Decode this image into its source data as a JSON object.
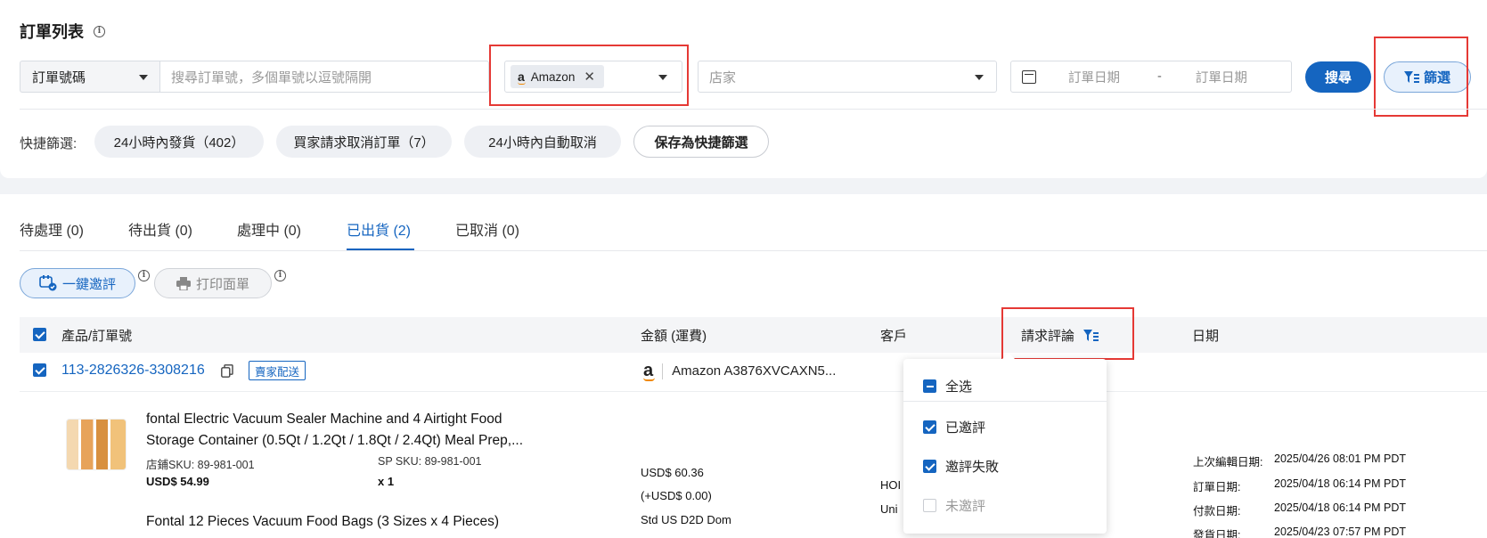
{
  "header": {
    "title": "訂單列表",
    "info_icon": "info-icon"
  },
  "search": {
    "type_selected": "訂單號碼",
    "placeholder": "搜尋訂單號，多個單號以逗號隔開",
    "platform_chip": "Amazon",
    "shop_placeholder": "店家",
    "date_start_placeholder": "訂單日期",
    "date_separator": "-",
    "date_end_placeholder": "訂單日期",
    "search_button": "搜尋",
    "filter_button": "篩選"
  },
  "quick_filters": {
    "label": "快捷篩選:",
    "items": [
      "24小時內發貨（402）",
      "買家請求取消訂單（7）",
      "24小時內自動取消"
    ],
    "save_button": "保存為快捷篩選"
  },
  "tabs": [
    {
      "label": "待處理 (0)",
      "active": false
    },
    {
      "label": "待出貨 (0)",
      "active": false
    },
    {
      "label": "處理中 (0)",
      "active": false
    },
    {
      "label": "已出貨 (2)",
      "active": true
    },
    {
      "label": "已取消 (0)",
      "active": false
    }
  ],
  "actions": {
    "review_button": "一鍵邀評",
    "print_button": "打印面單"
  },
  "table": {
    "headers": {
      "product": "產品/訂單號",
      "amount": "金額 (運費)",
      "customer": "客戶",
      "review": "請求評論",
      "date": "日期"
    },
    "order": {
      "order_no": "113-2826326-3308216",
      "tag": "賣家配送",
      "shop": "Amazon A3876XVCAXN5..."
    },
    "items": [
      {
        "name_line1": "fontal Electric Vacuum Sealer Machine and 4 Airtight Food",
        "name_line2": "Storage Container (0.5Qt / 1.2Qt / 1.8Qt / 2.4Qt) Meal Prep,...",
        "shop_sku": "店鋪SKU: 89-981-001",
        "sp_sku": "SP SKU: 89-981-001",
        "price": "USD$ 54.99",
        "qty": "x 1"
      },
      {
        "name_line1": "Fontal 12 Pieces Vacuum Food Bags (3 Sizes x 4 Pieces)"
      }
    ],
    "amount": {
      "total": "USD$ 60.36",
      "shipping": "(+USD$ 0.00)",
      "method": "Std US D2D Dom"
    },
    "customer_partial": [
      "HOI",
      "Uni"
    ],
    "dates": [
      {
        "label": "上次編輯日期:",
        "value": "2025/04/26 08:01 PM PDT"
      },
      {
        "label": "訂單日期:",
        "value": "2025/04/18 06:14 PM PDT"
      },
      {
        "label": "付款日期:",
        "value": "2025/04/18 06:14 PM PDT"
      },
      {
        "label": "發貨日期:",
        "value": "2025/04/23 07:57 PM PDT"
      }
    ]
  },
  "review_dropdown": {
    "options": [
      {
        "label": "全选",
        "state": "partial"
      },
      {
        "label": "已邀評",
        "state": "checked"
      },
      {
        "label": "邀評失敗",
        "state": "checked"
      },
      {
        "label": "未邀評",
        "state": "unchecked"
      }
    ]
  },
  "colors": {
    "accent": "#1565c0",
    "highlight_box": "#e53935",
    "background": "#f1f3f6"
  }
}
